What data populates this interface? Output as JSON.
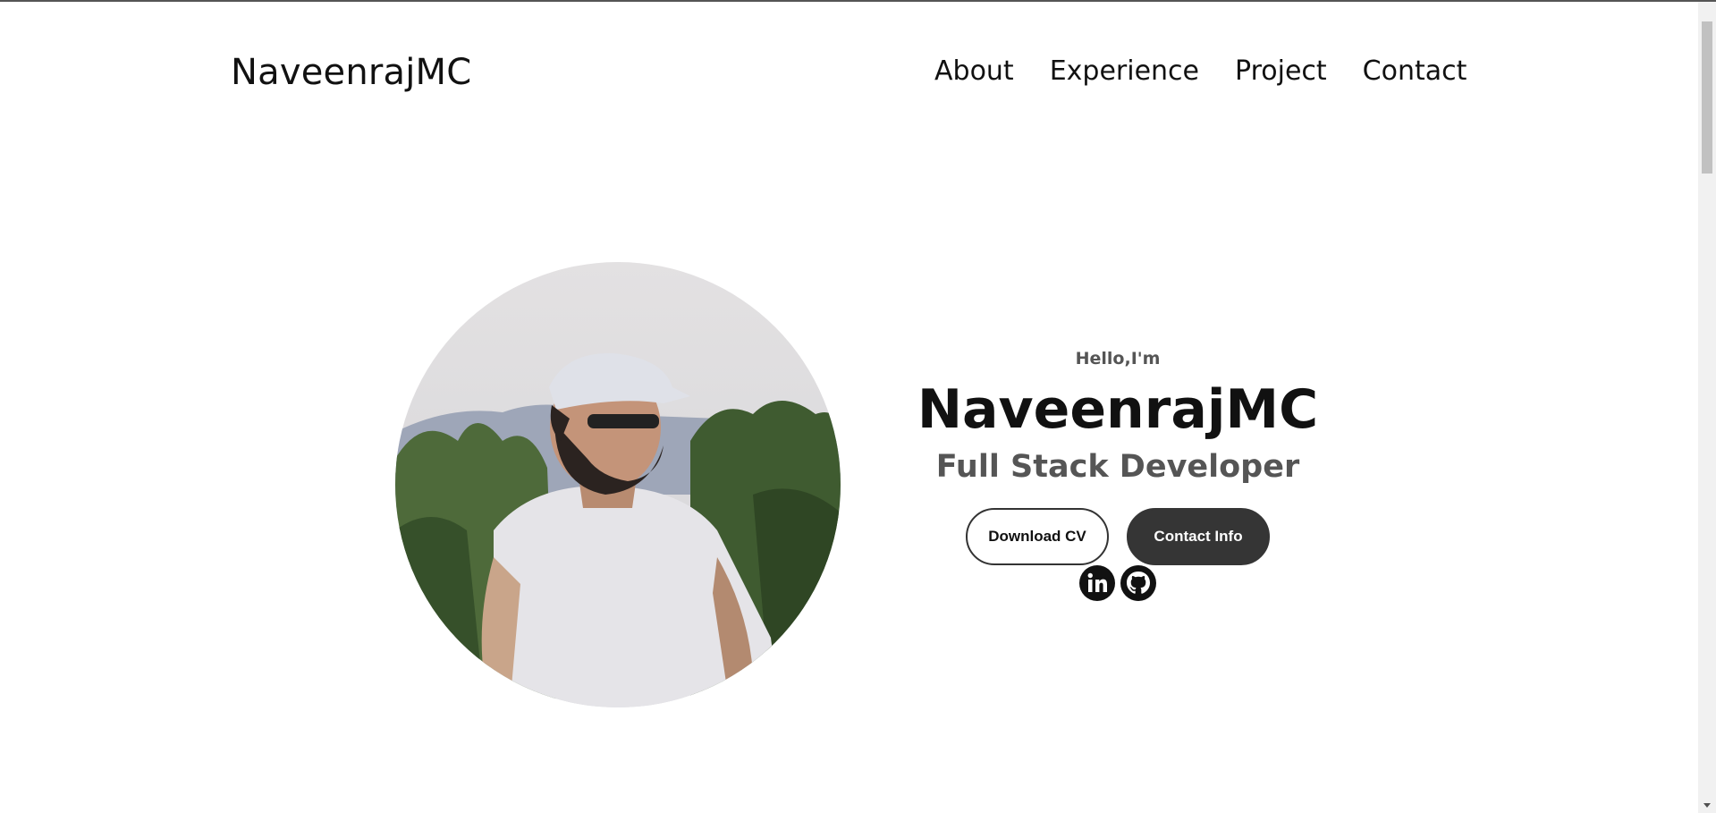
{
  "header": {
    "logo": "NaveenrajMC",
    "nav": [
      "About",
      "Experience",
      "Project",
      "Contact"
    ]
  },
  "hero": {
    "greeting": "Hello,I'm",
    "name": "NaveenrajMC",
    "role": "Full Stack Developer",
    "buttons": {
      "download": "Download CV",
      "contact": "Contact Info"
    },
    "photo_icon": "profile-photo",
    "socials": [
      "linkedin-icon",
      "github-icon"
    ]
  },
  "colors": {
    "text": "#111111",
    "muted": "#555555",
    "button_dark": "#353535",
    "background": "#ffffff"
  }
}
